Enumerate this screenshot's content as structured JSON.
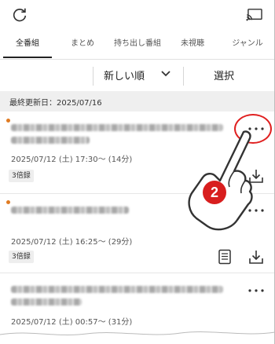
{
  "tabs": [
    {
      "label": "全番組",
      "active": true
    },
    {
      "label": "まとめ",
      "active": false
    },
    {
      "label": "持ち出し番組",
      "active": false
    },
    {
      "label": "未視聴",
      "active": false
    },
    {
      "label": "ジャンル",
      "active": false
    }
  ],
  "sort": {
    "current": "新しい順",
    "select_label": "選択"
  },
  "section": {
    "header": "最終更新日：2025/07/16"
  },
  "items": [
    {
      "title_hidden": true,
      "datetime": "2025/07/12 (土) 17:30～ (14分)",
      "badge": "3倍録",
      "is_new": true,
      "icons": [
        "more-icon",
        "download-icon"
      ]
    },
    {
      "title_hidden": true,
      "datetime": "2025/07/12 (土) 16:25～ (29分)",
      "badge": "3倍録",
      "is_new": true,
      "icons": [
        "more-icon",
        "document-icon",
        "download-icon"
      ]
    },
    {
      "title_hidden": true,
      "datetime": "2025/07/12 (土) 00:57～ (31分)",
      "badge": "",
      "is_new": false,
      "icons": [
        "more-icon"
      ]
    }
  ],
  "annotation": {
    "step_number": "2",
    "accent_color": "#e02020"
  },
  "colors": {
    "new_dot": "#e07b22",
    "section_bg": "#efefef",
    "highlight": "#e02020"
  }
}
